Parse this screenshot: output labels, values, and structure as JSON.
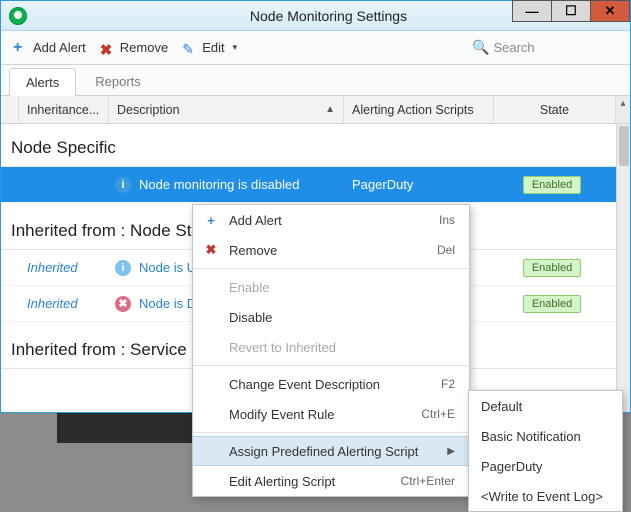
{
  "window": {
    "title": "Node Monitoring Settings"
  },
  "toolbar": {
    "add_alert": "Add Alert",
    "remove": "Remove",
    "edit": "Edit",
    "search_placeholder": "Search"
  },
  "tabs": {
    "alerts": "Alerts",
    "reports": "Reports"
  },
  "columns": {
    "inheritance": "Inheritance...",
    "description": "Description",
    "alerting_action": "Alerting Action Scripts",
    "state": "State"
  },
  "groups": {
    "node_specific": "Node Specific",
    "inherited_node_st": "Inherited from : Node St",
    "inherited_service": "Inherited from : Service"
  },
  "rows": {
    "r1": {
      "inh": "",
      "desc": "Node monitoring is disabled",
      "action": "PagerDuty",
      "state": "Enabled"
    },
    "r2": {
      "inh": "Inherited",
      "desc": "Node is UP",
      "action": "",
      "state": "Enabled"
    },
    "r3": {
      "inh": "Inherited",
      "desc": "Node is DO",
      "action": "",
      "state": "Enabled"
    }
  },
  "context_menu": {
    "add_alert": {
      "label": "Add Alert",
      "shortcut": "Ins"
    },
    "remove": {
      "label": "Remove",
      "shortcut": "Del"
    },
    "enable": {
      "label": "Enable"
    },
    "disable": {
      "label": "Disable"
    },
    "revert": {
      "label": "Revert to Inherited"
    },
    "change_desc": {
      "label": "Change Event Description",
      "shortcut": "F2"
    },
    "modify_rule": {
      "label": "Modify Event Rule",
      "shortcut": "Ctrl+E"
    },
    "assign_script": {
      "label": "Assign Predefined Alerting Script"
    },
    "edit_script": {
      "label": "Edit Alerting Script",
      "shortcut": "Ctrl+Enter"
    }
  },
  "submenu": {
    "default": "Default",
    "basic": "Basic Notification",
    "pagerduty": "PagerDuty",
    "eventlog": "<Write to Event Log>"
  }
}
